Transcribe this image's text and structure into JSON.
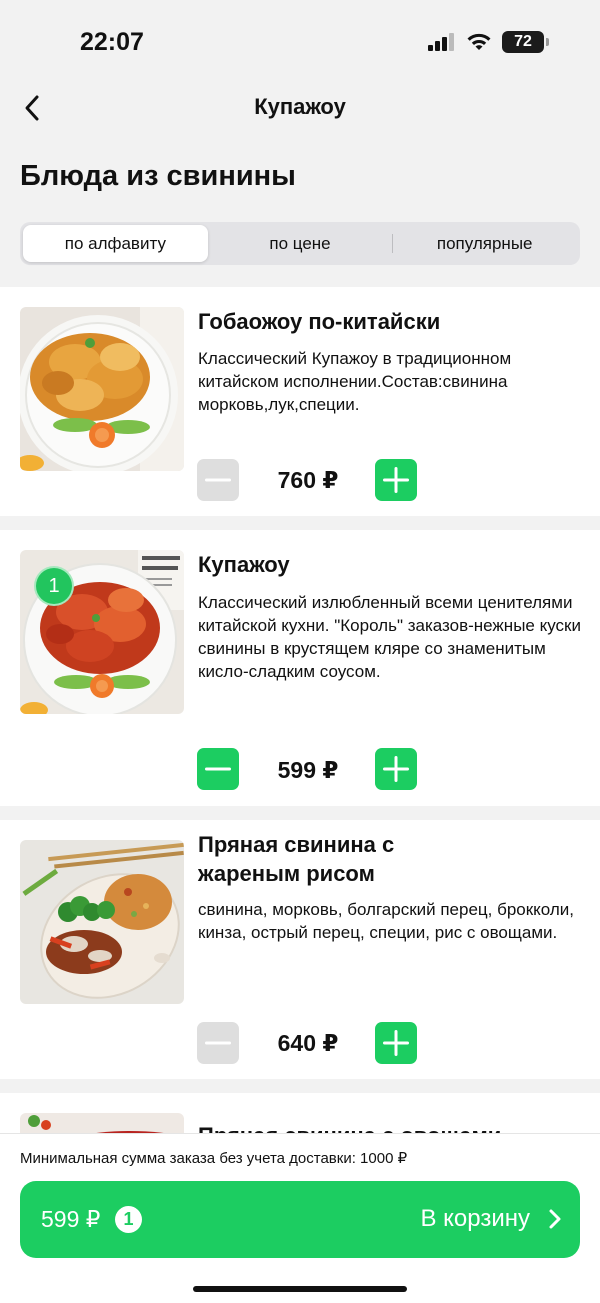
{
  "status": {
    "time": "22:07",
    "battery": "72"
  },
  "nav": {
    "title": "Купажоу"
  },
  "page": {
    "title": "Блюда из свинины"
  },
  "sort": {
    "tabs": [
      "по алфавиту",
      "по цене",
      "популярные"
    ],
    "active": 0
  },
  "dishes": [
    {
      "name": "Гобаожоу по-китайски",
      "description": "Классический Купажоу в традиционном китайском исполнении.Состав:свинина морковь,лук,специи.",
      "price": "760 ₽",
      "quantity": 0
    },
    {
      "name": "Купажоу",
      "description": "Классический излюбленный всеми ценителями китайской кухни. \"Король\" заказов-нежные куски свинины в крустящем кляре со знаменитым кисло-сладким соусом.",
      "price": "599 ₽",
      "quantity": 1,
      "badge": "1"
    },
    {
      "name": "Пряная свинина с жареным рисом",
      "description": "свинина, морковь, болгарский перец, брокколи, кинза, острый перец, специи, рис с овощами.",
      "price": "640 ₽",
      "quantity": 0
    },
    {
      "name": "Пряная свинина с овощами"
    }
  ],
  "footer": {
    "min_order": "Минимальная сумма заказа без учета доставки: 1000 ₽",
    "cart_total": "599 ₽",
    "cart_count": "1",
    "cart_label": "В корзину"
  },
  "colors": {
    "accent": "#1ccd61",
    "background": "#f2f2f2",
    "disabled": "#dedede"
  },
  "icons": [
    "cellular-signal-icon",
    "wifi-icon",
    "battery-icon",
    "back-chevron-icon",
    "minus-icon",
    "plus-icon",
    "chevron-right-icon"
  ]
}
